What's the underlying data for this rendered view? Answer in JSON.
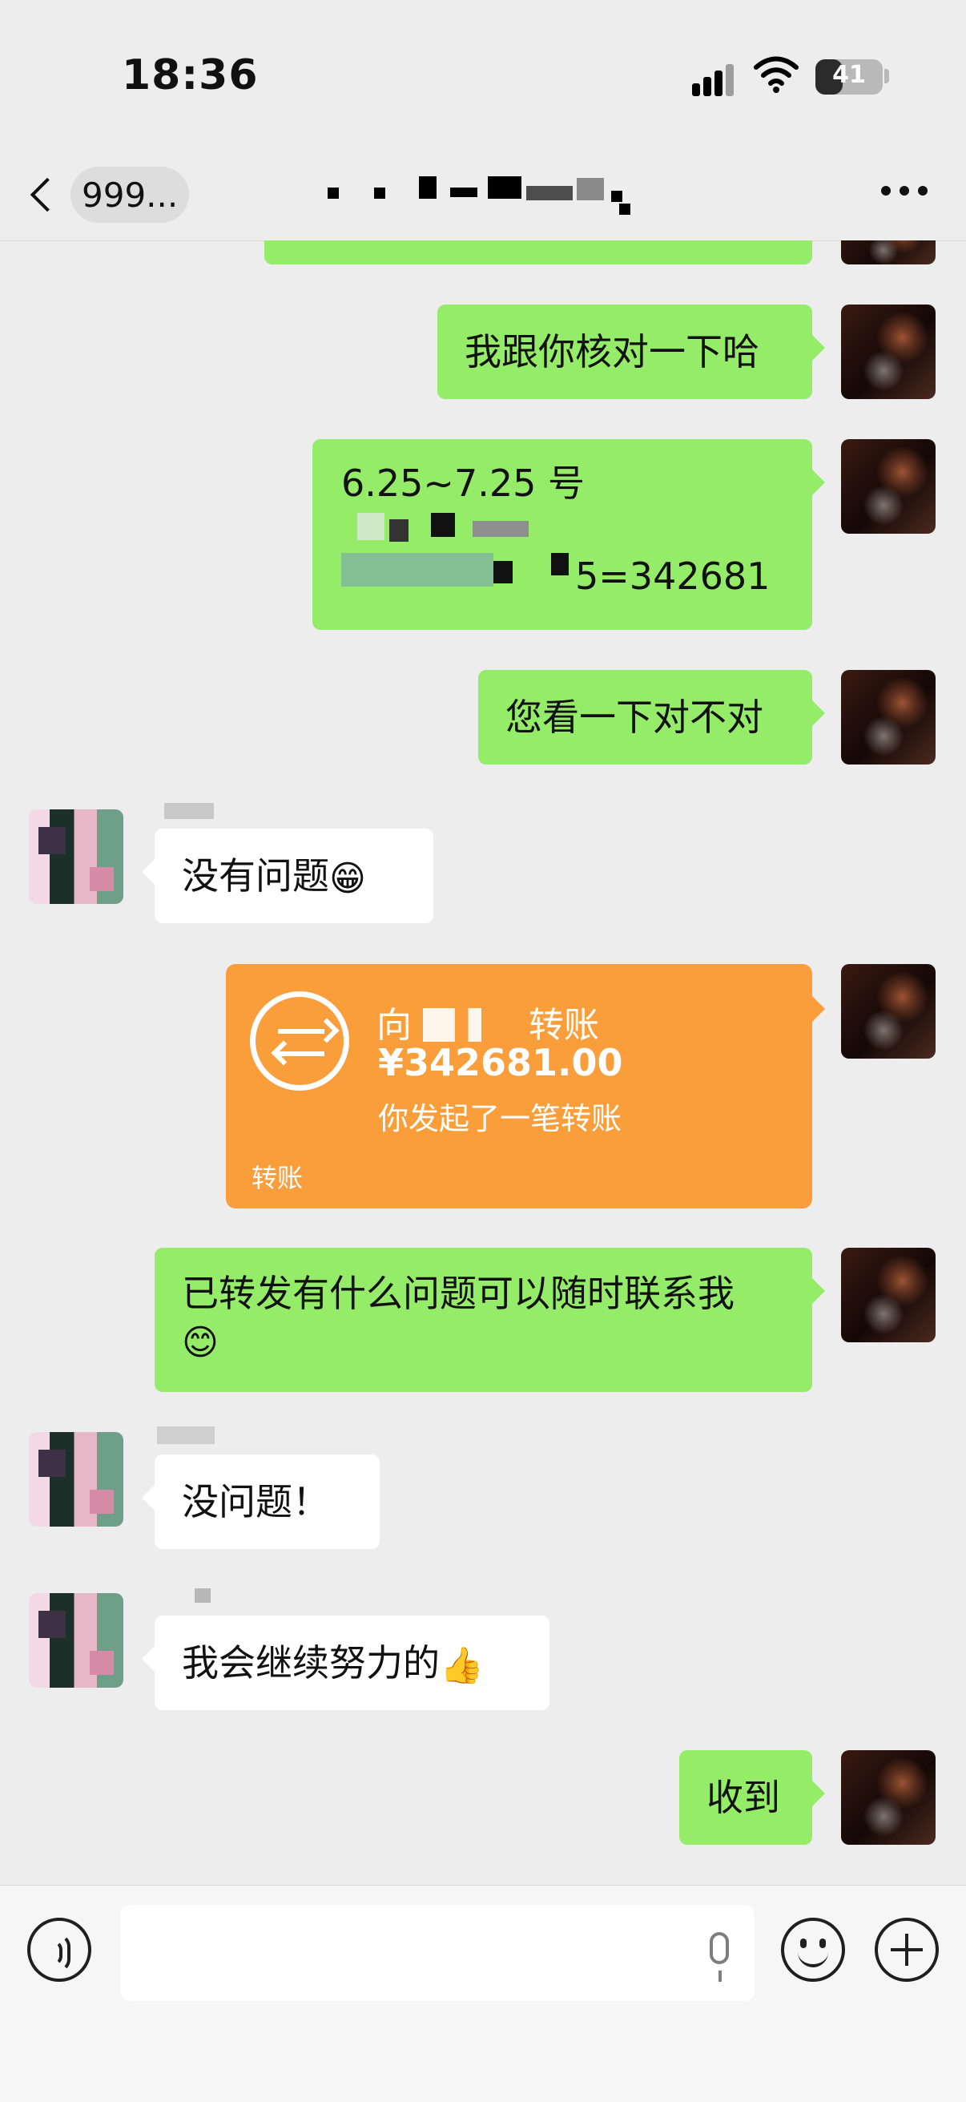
{
  "status": {
    "time": "18:36",
    "battery_level": "41"
  },
  "nav": {
    "back_count": "999..."
  },
  "messages": [
    {
      "text": "我跟你核对一下哈"
    },
    {
      "lines": [
        "6.25~7.25 号",
        "5=342681"
      ]
    },
    {
      "text": "您看一下对不对"
    },
    {
      "text": "没有问题",
      "emoji": "😁"
    },
    {
      "type": "transfer",
      "line1_start": "向",
      "line1_end": "转账",
      "amount": "¥342681.00",
      "note": "你发起了一笔转账",
      "footer": "转账"
    },
    {
      "text": "已转发有什么问题可以随时联系我",
      "emoji": "😊"
    },
    {
      "text": "没问题！"
    },
    {
      "text": "我会继续努力的",
      "emoji": "👍"
    },
    {
      "text": "收到"
    }
  ]
}
